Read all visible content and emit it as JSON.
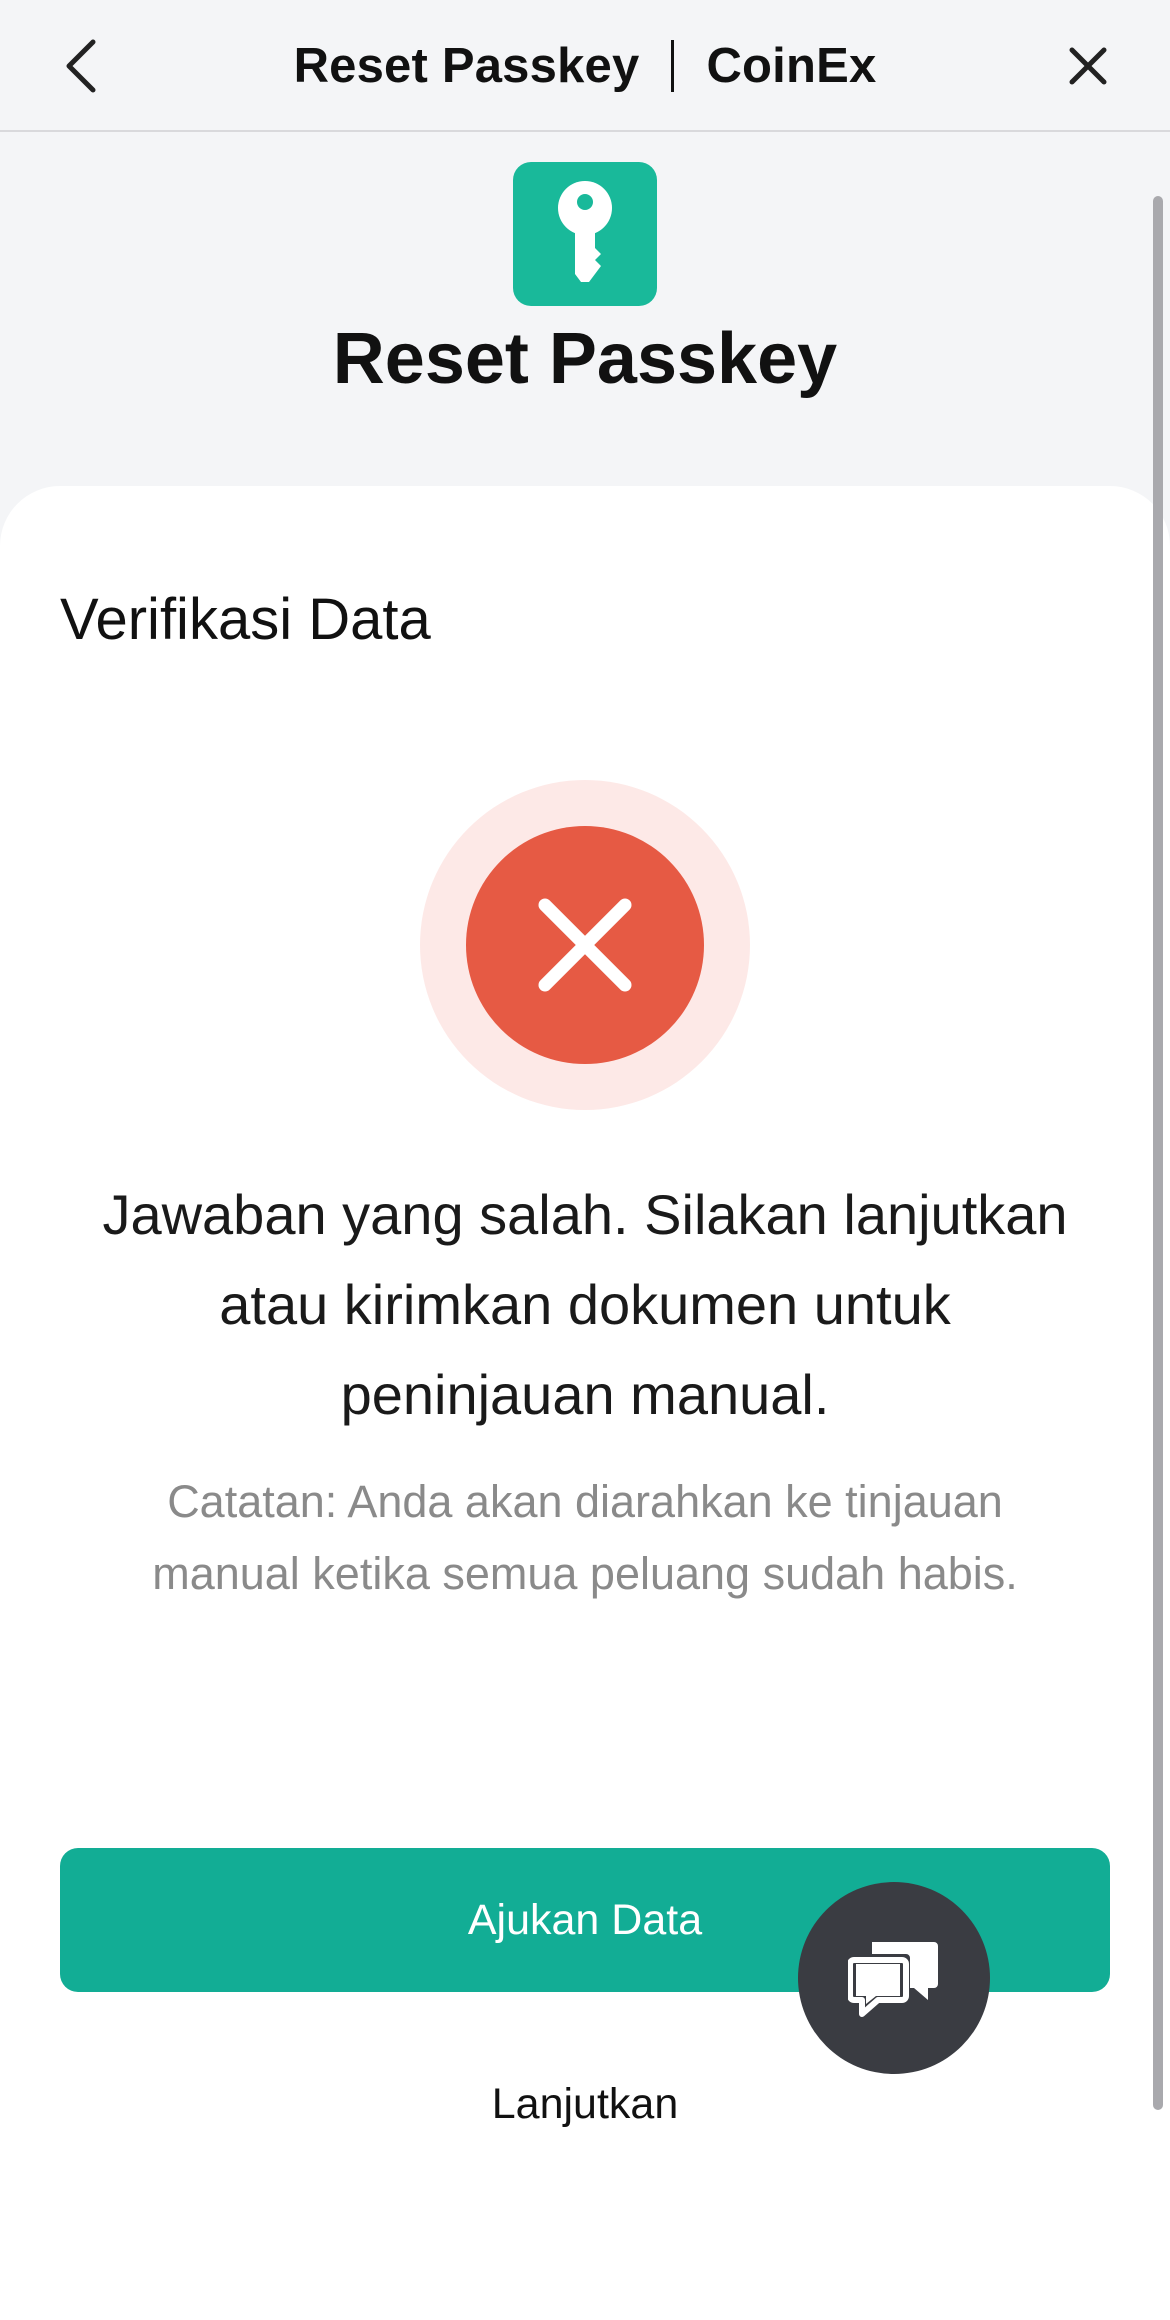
{
  "navbar": {
    "title_left": "Reset Passkey",
    "title_right": "CoinEx",
    "back_icon": "chevron-left-icon",
    "close_icon": "close-icon"
  },
  "header": {
    "badge_icon": "key-icon",
    "badge_color": "#19b99a",
    "title": "Reset Passkey"
  },
  "card": {
    "section_title": "Verifikasi Data",
    "status_icon": "error-x-icon",
    "status_color": "#e65a44",
    "message": "Jawaban yang salah. Silakan lanjutkan atau kirimkan dokumen untuk peninjauan manual.",
    "note": "Catatan: Anda akan diarahkan ke tinjauan manual ketika semua peluang sudah habis.",
    "submit_label": "Ajukan Data",
    "submit_color": "#12ad95",
    "continue_label": "Lanjutkan",
    "chat_icon": "chat-bubbles-icon"
  }
}
